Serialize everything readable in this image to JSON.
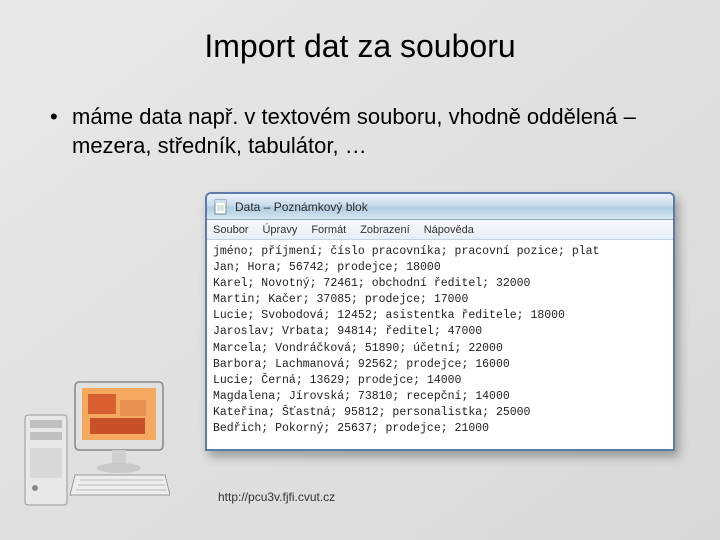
{
  "title": "Import dat za souboru",
  "bullet": "máme data např. v textovém souboru, vhodně oddělená – mezera, středník, tabulátor, …",
  "window": {
    "title": "Data – Poznámkový blok",
    "menus": [
      "Soubor",
      "Úpravy",
      "Formát",
      "Zobrazení",
      "Nápověda"
    ],
    "lines": [
      "jméno; příjmení; číslo pracovníka; pracovní pozice; plat",
      "Jan; Hora; 56742; prodejce; 18000",
      "Karel; Novotný; 72461; obchodní ředitel; 32000",
      "Martin; Kačer; 37085; prodejce; 17000",
      "Lucie; Svobodová; 12452; asistentka ředitele; 18000",
      "Jaroslav; Vrbata; 94814; ředitel; 47000",
      "Marcela; Vondráčková; 51890; účetní; 22000",
      "Barbora; Lachmanová; 92562; prodejce; 16000",
      "Lucie; Černá; 13629; prodejce; 14000",
      "Magdalena; Jírovská; 73810; recepční; 14000",
      "Kateřina; Šťastná; 95812; personalistka; 25000",
      "Bedřich; Pokorný; 25637; prodejce; 21000"
    ]
  },
  "footer_url": "http://pcu3v.fjfi.cvut.cz"
}
